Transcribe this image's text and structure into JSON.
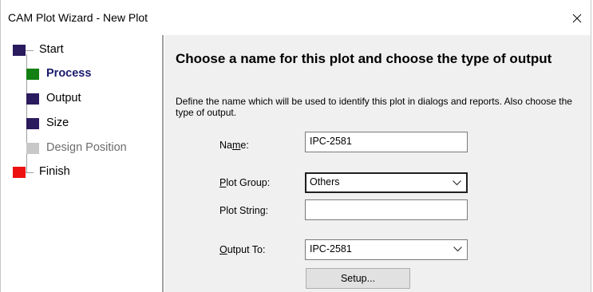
{
  "window": {
    "title": "CAM Plot  Wizard - New Plot"
  },
  "steps": [
    {
      "label": "Start",
      "state": "done",
      "color": "#2a1a5e"
    },
    {
      "label": "Process",
      "state": "active",
      "color": "#128012"
    },
    {
      "label": "Output",
      "state": "pending",
      "color": "#2a1a5e"
    },
    {
      "label": "Size",
      "state": "pending",
      "color": "#2a1a5e"
    },
    {
      "label": "Design Position",
      "state": "disabled",
      "color": "#c8c8c8"
    },
    {
      "label": "Finish",
      "state": "end",
      "color": "#ee1111"
    }
  ],
  "content": {
    "heading": "Choose a name for this plot and choose the type of output",
    "description": "Define the name which will be used to identify this plot in dialogs and reports. Also choose the type of output."
  },
  "form": {
    "name_label": "Name:",
    "name_value": "IPC-2581",
    "plot_group_label": "Plot Group:",
    "plot_group_value": "Others",
    "plot_string_label": "Plot String:",
    "plot_string_value": "",
    "output_to_label": "Output To:",
    "output_to_value": "IPC-2581",
    "setup_label": "Setup..."
  }
}
